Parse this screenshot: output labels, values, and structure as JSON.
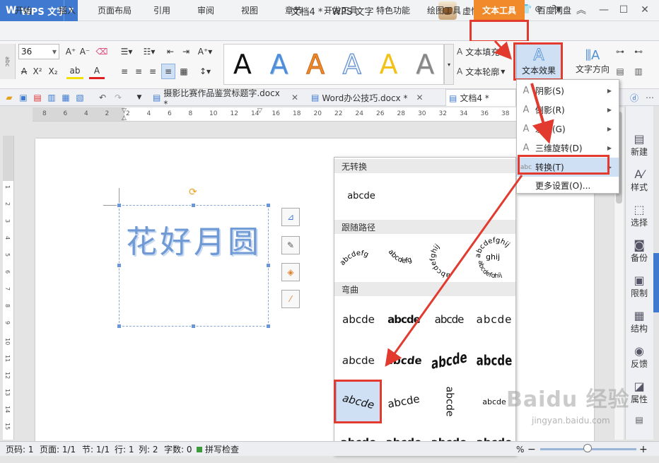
{
  "app": {
    "name": "WPS 文字",
    "window_title": "文档4 * - WPS 文字",
    "user": "虚怀若谷"
  },
  "menus": [
    "开始",
    "插入",
    "页面布局",
    "引用",
    "审阅",
    "视图",
    "章节",
    "开发工具",
    "特色功能",
    "绘图工具",
    "文本工具",
    "百度网盘"
  ],
  "ribbon": {
    "font_size": "36",
    "gallery_letter": "A",
    "text_fill": "文本填充",
    "text_outline": "文本轮廓",
    "text_effect": "文本效果",
    "text_direction": "文字方向"
  },
  "doc_tabs": [
    "摄影比赛作品鉴赏标题字.docx *",
    "Word办公技巧.docx *",
    "文档4 *"
  ],
  "ruler_numbers": [
    "8",
    "6",
    "4",
    "2",
    "2",
    "4",
    "6",
    "8",
    "10",
    "12",
    "14",
    "16",
    "18",
    "20",
    "22",
    "24",
    "26",
    "28",
    "30",
    "32",
    "34",
    "36",
    "38"
  ],
  "vruler_numbers": [
    "1",
    "2",
    "3",
    "4",
    "5",
    "6",
    "7",
    "8",
    "9",
    "10",
    "11",
    "12",
    "13",
    "14",
    "15"
  ],
  "doc_text": "花好月圆",
  "dropdown": {
    "items": [
      "阴影(S)",
      "倒影(R)",
      "发光(G)",
      "三维旋转(D)",
      "转换(T)",
      "更多设置(O)..."
    ]
  },
  "panel": {
    "no_transform": "无转换",
    "no_transform_sample": "abcde",
    "follow_path": "跟随路径",
    "follow_path_samples": [
      "abcdefg",
      "abcdefg",
      "abcdefghij",
      "abcdefghij"
    ],
    "warp": "弯曲",
    "warp_rows": [
      [
        "abcde",
        "abcde",
        "abcde",
        "abcde"
      ],
      [
        "abcde",
        "abcde",
        "abcde",
        "abcde"
      ],
      [
        "abcde",
        "abcde",
        "abcde",
        "abcde"
      ],
      [
        "abcde",
        "abcde",
        "abcde",
        "abcde"
      ]
    ]
  },
  "right_sidebar": [
    "新建",
    "样式",
    "选择",
    "备份",
    "限制",
    "结构",
    "反馈",
    "属性"
  ],
  "status": {
    "page": "页码: 1",
    "pages": "页面: 1/1",
    "section": "节: 1/1",
    "line": "行: 1",
    "col": "列: 2",
    "words": "字数: 0",
    "spell": "拼写检查",
    "zoom": "%"
  },
  "watermark": {
    "site": "jingyan.baidu.com"
  },
  "colors": {
    "accent_orange": "#f08a2a",
    "highlight_red": "#e23a2f",
    "wps_blue": "#3f7ad0",
    "text_blue": "#6f9ad6"
  }
}
